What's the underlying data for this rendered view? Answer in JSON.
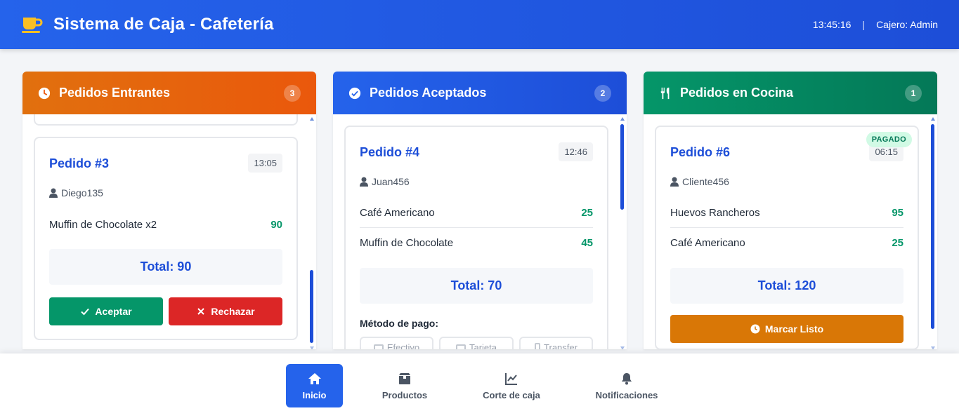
{
  "header": {
    "title": "Sistema de Caja - Cafetería",
    "brand_icon": "coffee-cup-icon",
    "time": "13:45:16",
    "separator": "|",
    "cashier": "Cajero: Admin"
  },
  "columns": {
    "incoming": {
      "title": "Pedidos Entrantes",
      "count": "3",
      "icon": "clock-icon",
      "color": "#ea580c",
      "order": {
        "title": "Pedido #3",
        "time": "13:05",
        "customer": "Diego135",
        "items": [
          {
            "name": "Muffin de Chocolate x2",
            "price": "90"
          }
        ],
        "total": "Total: 90",
        "accept_label": "Aceptar",
        "reject_label": "Rechazar"
      }
    },
    "accepted": {
      "title": "Pedidos Aceptados",
      "count": "2",
      "icon": "check-circle-icon",
      "color": "#2563eb",
      "order": {
        "title": "Pedido #4",
        "time": "12:46",
        "customer": "Juan456",
        "items": [
          {
            "name": "Café Americano",
            "price": "25"
          },
          {
            "name": "Muffin de Chocolate",
            "price": "45"
          }
        ],
        "total": "Total: 70",
        "payment_label": "Método de pago:",
        "payment_options": [
          "Efectivo",
          "Tarjeta",
          "Transfer"
        ]
      }
    },
    "kitchen": {
      "title": "Pedidos en Cocina",
      "count": "1",
      "icon": "utensils-icon",
      "color": "#059669",
      "order": {
        "title": "Pedido #6",
        "time": "06:15",
        "paid_badge": "PAGADO",
        "customer": "Cliente456",
        "items": [
          {
            "name": "Huevos Rancheros",
            "price": "95"
          },
          {
            "name": "Café Americano",
            "price": "25"
          }
        ],
        "total": "Total: 120",
        "ready_label": "Marcar Listo"
      }
    }
  },
  "nav": {
    "items": [
      {
        "label": "Inicio",
        "icon": "home-icon",
        "active": true
      },
      {
        "label": "Productos",
        "icon": "box-icon",
        "active": false
      },
      {
        "label": "Corte de caja",
        "icon": "chart-line-icon",
        "active": false
      },
      {
        "label": "Notificaciones",
        "icon": "bell-icon",
        "active": false
      }
    ]
  }
}
